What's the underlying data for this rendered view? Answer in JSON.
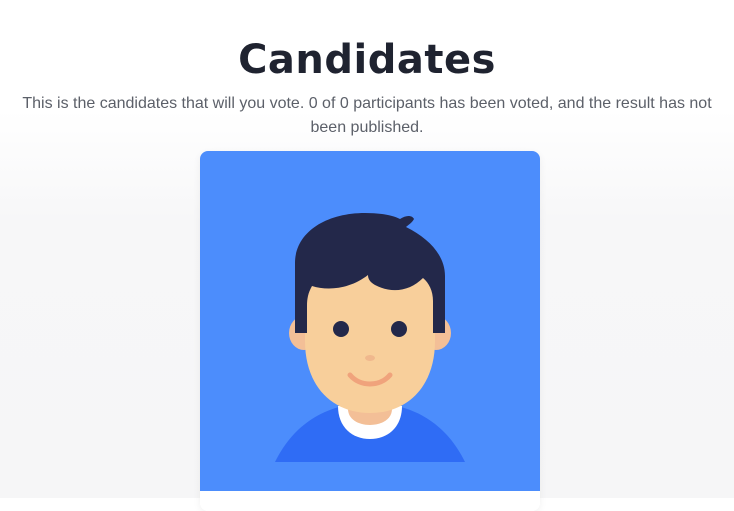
{
  "header": {
    "title": "Candidates",
    "description": "This is the candidates that will you vote. 0 of 0 participants has been voted, and the result has not been published."
  },
  "candidates": [
    {
      "avatar_icon": "male-avatar-icon",
      "card_color": "#4c8dfc"
    }
  ]
}
